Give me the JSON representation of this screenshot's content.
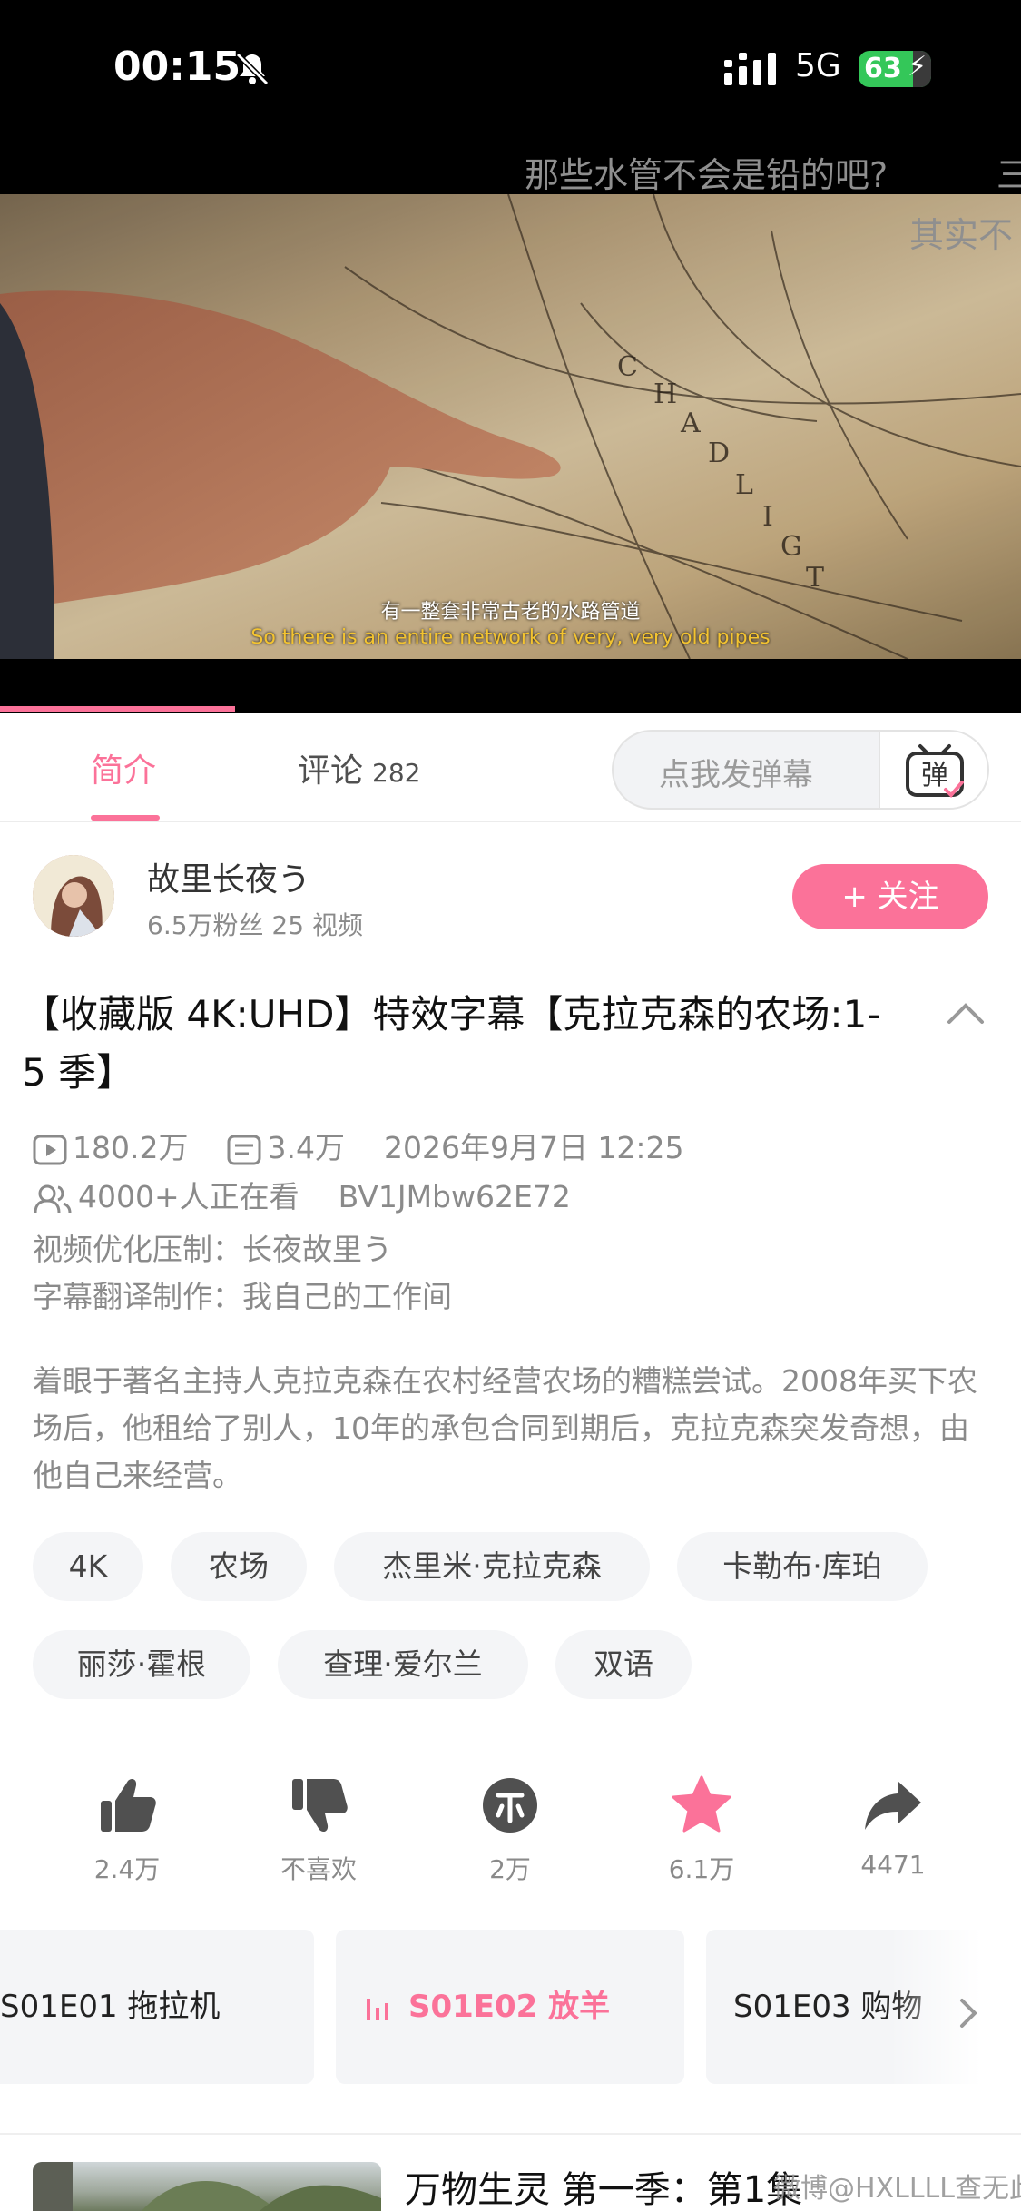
{
  "status_bar": {
    "time": "00:15",
    "network": "5G",
    "battery": "63",
    "colors": {
      "battery": "#34c759"
    }
  },
  "video": {
    "danmaku": [
      "那些水管不会是铅的吧?",
      "三",
      "其实不"
    ],
    "subtitle_cn": "有一整套非常古老的水路管道",
    "subtitle_en": "So there is an entire network of very, very old pipes",
    "progress": 0.23
  },
  "tabs": {
    "intro": "简介",
    "comments": "评论",
    "comments_count": "282",
    "danmaku_placeholder": "点我发弹幕",
    "danmaku_button": "弹"
  },
  "uploader": {
    "name": "故里长夜う",
    "stats": "6.5万粉丝   25 视频",
    "follow_label": "+ 关注"
  },
  "video_info": {
    "title": "【收藏版 4K:UHD】特效字幕【克拉克森的农场:1-5 季】",
    "views": "180.2万",
    "danmaku_count": "3.4万",
    "date": "2026年9月7日 12:25",
    "watching": "4000+人正在看",
    "bvid": "BV1JMbw62E72",
    "credit_1": "视频优化压制：长夜故里う",
    "credit_2": "字幕翻译制作：我自己的工作间",
    "description": "着眼于著名主持人克拉克森在农村经营农场的糟糕尝试。2008年买下农场后，他租给了别人，10年的承包合同到期后，克拉克森突发奇想，由他自己来经营。"
  },
  "tags": [
    "4K",
    "农场",
    "杰里米·克拉克森",
    "卡勒布·库珀",
    "丽莎·霍根",
    "查理·爱尔兰",
    "双语"
  ],
  "actions": {
    "like": "2.4万",
    "dislike": "不喜欢",
    "coin": "2万",
    "favorite": "6.1万",
    "share": "4471"
  },
  "episodes": [
    {
      "label": "S01E01 拖拉机",
      "active": false
    },
    {
      "label": "S01E02 放羊",
      "active": true
    },
    {
      "label": "S01E03 购物",
      "active": false
    }
  ],
  "recommendation": {
    "title": "万物生灵 第一季：第1集",
    "watermark": "微博@HXLLLL查无此人"
  },
  "colors": {
    "accent": "#fb7299",
    "muted": "#8a8a8a"
  }
}
